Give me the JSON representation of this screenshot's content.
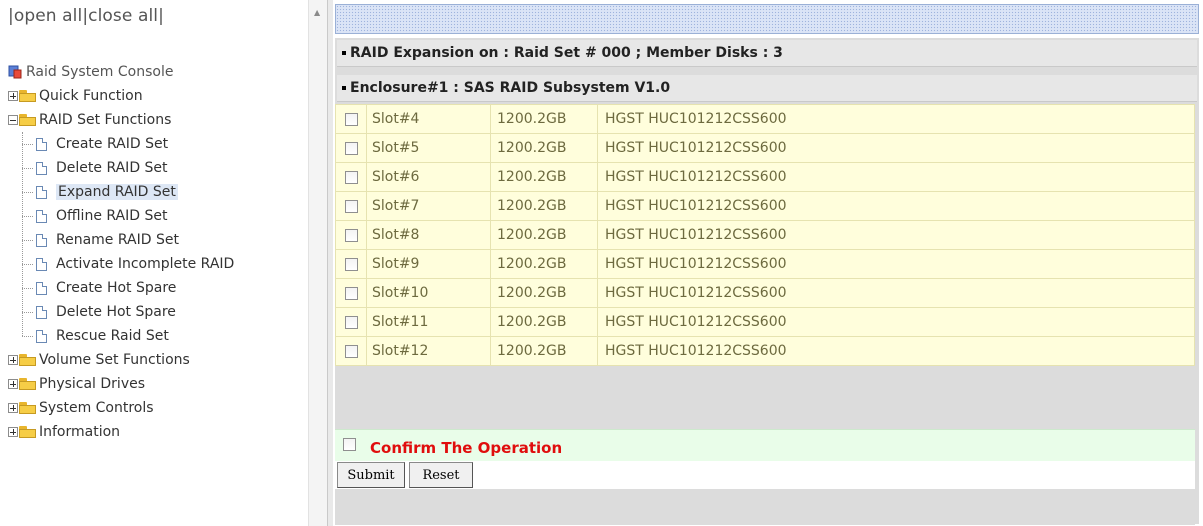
{
  "nav": {
    "open_all": "open all",
    "close_all": "close all",
    "console": "Raid System Console",
    "groups": [
      {
        "label": "Quick Function",
        "expanded": false
      },
      {
        "label": "RAID Set Functions",
        "expanded": true
      },
      {
        "label": "Volume Set Functions",
        "expanded": false
      },
      {
        "label": "Physical Drives",
        "expanded": false
      },
      {
        "label": "System Controls",
        "expanded": false
      },
      {
        "label": "Information",
        "expanded": false
      }
    ],
    "raid_items": [
      "Create RAID Set",
      "Delete RAID Set",
      "Expand RAID Set",
      "Offline RAID Set",
      "Rename RAID Set",
      "Activate Incomplete RAID",
      "Create Hot Spare",
      "Delete Hot Spare",
      "Rescue Raid Set"
    ],
    "selected_item": "Expand RAID Set"
  },
  "main": {
    "expansion_header": "RAID Expansion on : Raid Set # 000 ; Member Disks : 3",
    "enclosure_header": "Enclosure#1 : SAS RAID Subsystem V1.0",
    "disks": [
      {
        "slot": "Slot#4",
        "capacity": "1200.2GB",
        "model": "HGST HUC101212CSS600"
      },
      {
        "slot": "Slot#5",
        "capacity": "1200.2GB",
        "model": "HGST HUC101212CSS600"
      },
      {
        "slot": "Slot#6",
        "capacity": "1200.2GB",
        "model": "HGST HUC101212CSS600"
      },
      {
        "slot": "Slot#7",
        "capacity": "1200.2GB",
        "model": "HGST HUC101212CSS600"
      },
      {
        "slot": "Slot#8",
        "capacity": "1200.2GB",
        "model": "HGST HUC101212CSS600"
      },
      {
        "slot": "Slot#9",
        "capacity": "1200.2GB",
        "model": "HGST HUC101212CSS600"
      },
      {
        "slot": "Slot#10",
        "capacity": "1200.2GB",
        "model": "HGST HUC101212CSS600"
      },
      {
        "slot": "Slot#11",
        "capacity": "1200.2GB",
        "model": "HGST HUC101212CSS600"
      },
      {
        "slot": "Slot#12",
        "capacity": "1200.2GB",
        "model": "HGST HUC101212CSS600"
      }
    ],
    "confirm_label": "Confirm The Operation",
    "submit_label": "Submit",
    "reset_label": "Reset"
  },
  "colors": {
    "confirm_text": "#e00d0d",
    "disk_row_bg": "#fffedc",
    "confirm_bg": "#e9fde9"
  }
}
